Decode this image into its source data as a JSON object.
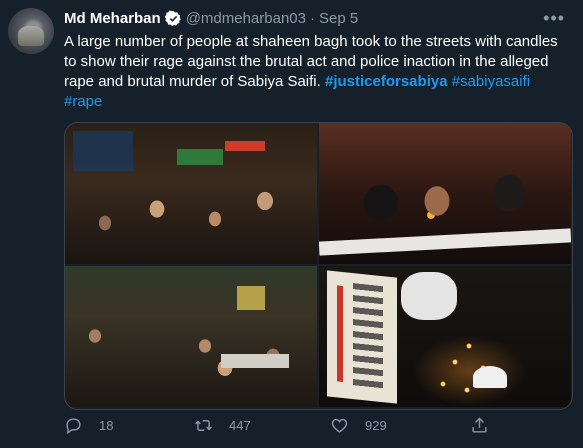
{
  "author": {
    "name": "Md Meharban",
    "handle": "@mdmeharban03",
    "separator": "·",
    "date": "Sep 5",
    "verified_icon": "verified-badge-icon"
  },
  "tweet": {
    "text": "A large number of people at shaheen bagh took to the streets with candles to show their rage against the brutal act and police inaction in the alleged rape and brutal murder of Sabiya Saifi.",
    "hashtags": [
      "#justiceforsabiya",
      "#sabiyasaifi",
      "#rape"
    ]
  },
  "more_icon": "more-options-icon",
  "media": {
    "photo_count": 4
  },
  "actions": {
    "reply_count": "18",
    "retweet_count": "447",
    "like_count": "929"
  },
  "colors": {
    "background": "#15202b",
    "text": "#ffffff",
    "secondary": "#8b98a5",
    "link": "#1d9bf0"
  }
}
